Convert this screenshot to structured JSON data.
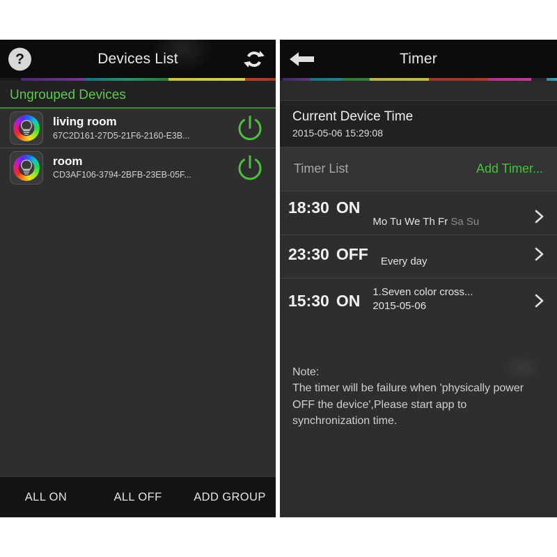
{
  "devices_panel": {
    "titlebar": {
      "title": "Devices List",
      "help_label": "?",
      "help_icon": "question-mark-circle-icon",
      "refresh_icon": "refresh-icon"
    },
    "group": {
      "label": "Ungrouped Devices",
      "accent_color": "#5cc94e"
    },
    "devices": [
      {
        "name": "living room",
        "uuid": "67C2D161-27D5-21F6-2160-E3B...",
        "icon": "rgb-bulb-icon",
        "power_icon": "power-icon",
        "power_color": "#4fbf3f"
      },
      {
        "name": "room",
        "uuid": "CD3AF106-3794-2BFB-23EB-05F...",
        "icon": "rgb-bulb-icon",
        "power_icon": "power-icon",
        "power_color": "#4fbf3f"
      }
    ],
    "bottom_bar": {
      "all_on": "ALL ON",
      "all_off": "ALL OFF",
      "add_group": "ADD GROUP"
    }
  },
  "timer_panel": {
    "titlebar": {
      "title": "Timer",
      "back_icon": "back-arrow-icon"
    },
    "current_device_time": {
      "label": "Current Device Time",
      "value": "2015-05-06 15:29:08"
    },
    "timer_list": {
      "title": "Timer List",
      "add_label": "Add Timer...",
      "add_color": "#44c33c"
    },
    "timers": [
      {
        "time": "18:30",
        "state": "ON",
        "days_active": "Mo Tu We Th Fr",
        "days_inactive": "Sa Su",
        "detail2": "",
        "chevron_icon": "chevron-right-icon"
      },
      {
        "time": "23:30",
        "state": "OFF",
        "days_active": "Every day",
        "days_inactive": "",
        "detail2": "",
        "chevron_icon": "chevron-right-icon"
      },
      {
        "time": "15:30",
        "state": "ON",
        "days_active": "1.Seven color cross...",
        "days_inactive": "",
        "detail2": "2015-05-06",
        "chevron_icon": "chevron-right-icon"
      }
    ],
    "note": {
      "line1": "Note:",
      "line2": "The timer will be failure when 'physically power",
      "line3": "OFF the device',Please start app to",
      "line4": "synchronization time."
    }
  },
  "theme": {
    "panel_bg": "#2e2e2e",
    "titlebar_bg": "#0c0c0c",
    "accent_green": "#4fbf3f"
  }
}
